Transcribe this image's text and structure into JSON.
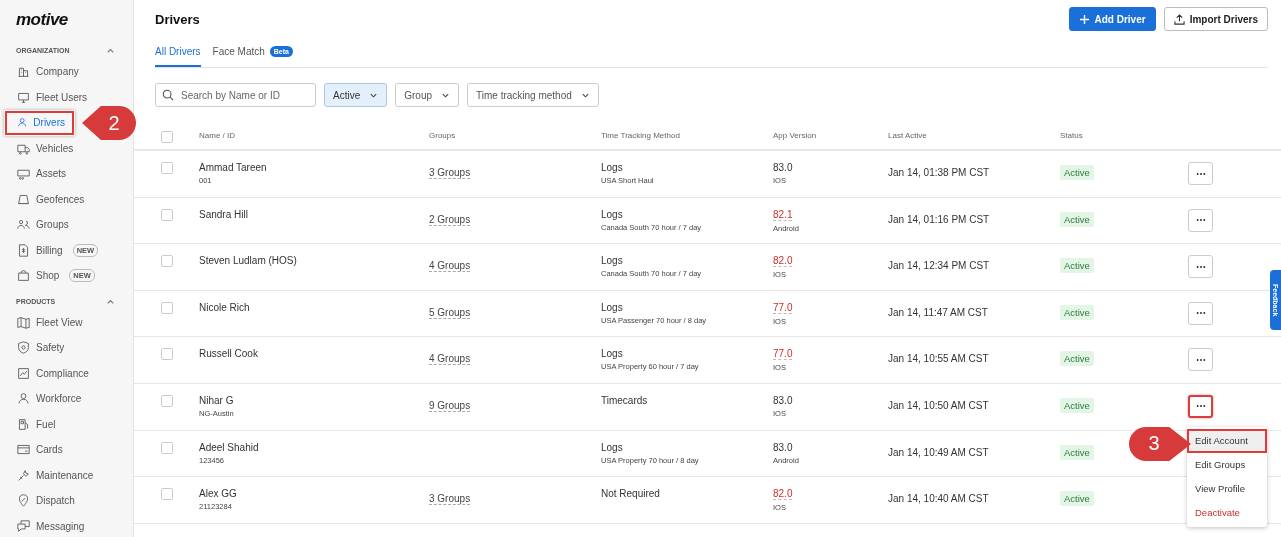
{
  "sidebar": {
    "logo": "motive",
    "sections": [
      {
        "title": "ORGANIZATION",
        "expanded": true,
        "items": [
          {
            "label": "Company",
            "selected": false
          },
          {
            "label": "Fleet Users",
            "selected": false
          },
          {
            "label": "Drivers",
            "selected": true,
            "callout": "2"
          },
          {
            "label": "Vehicles",
            "selected": false
          },
          {
            "label": "Assets",
            "selected": false
          },
          {
            "label": "Geofences",
            "selected": false
          },
          {
            "label": "Groups",
            "selected": false
          },
          {
            "label": "Billing",
            "selected": false,
            "badge": "NEW"
          },
          {
            "label": "Shop",
            "selected": false,
            "badge": "NEW"
          }
        ]
      },
      {
        "title": "PRODUCTS",
        "expanded": true,
        "items": [
          {
            "label": "Fleet View",
            "selected": false
          },
          {
            "label": "Safety",
            "selected": false
          },
          {
            "label": "Compliance",
            "selected": false
          },
          {
            "label": "Workforce",
            "selected": false
          },
          {
            "label": "Fuel",
            "selected": false
          },
          {
            "label": "Cards",
            "selected": false
          },
          {
            "label": "Maintenance",
            "selected": false
          },
          {
            "label": "Dispatch",
            "selected": false
          },
          {
            "label": "Messaging",
            "selected": false
          }
        ]
      }
    ]
  },
  "page": {
    "title": "Drivers",
    "buttons": [
      {
        "label": "Add Driver",
        "kind": "primary"
      },
      {
        "label": "Import Drivers",
        "kind": "secondary"
      }
    ]
  },
  "tabs": [
    {
      "label": "All Drivers",
      "selected": true
    },
    {
      "label": "Face Match",
      "selected": false,
      "badge": "Beta"
    }
  ],
  "filters": {
    "search": {
      "placeholder": "Search by Name or ID"
    },
    "dropdowns": [
      {
        "label": "Active",
        "selected": true
      },
      {
        "label": "Group",
        "selected": false
      },
      {
        "label": "Time tracking method",
        "selected": false
      }
    ]
  },
  "table": {
    "all_checked": false,
    "columns": [
      "Name / ID",
      "Groups",
      "Time Tracking Method",
      "App Version",
      "Last Active",
      "Status"
    ],
    "rows": [
      {
        "checked": false,
        "name": "Ammad Tareen",
        "id": "001",
        "groups": "3 Groups",
        "method": "Logs",
        "method_detail": "USA Short Haul",
        "version": "83.0",
        "outdated": false,
        "platform": "IOS",
        "last_active": "Jan 14, 01:38 PM CST",
        "status": "Active",
        "highlighted": false
      },
      {
        "checked": false,
        "name": "Sandra Hill",
        "groups": "2 Groups",
        "method": "Logs",
        "method_detail": "Canada South 70 hour / 7 day",
        "version": "82.1",
        "outdated": true,
        "platform": "Android",
        "last_active": "Jan 14, 01:16 PM CST",
        "status": "Active",
        "highlighted": false
      },
      {
        "checked": false,
        "name": "Steven Ludlam (HOS)",
        "groups": "4 Groups",
        "method": "Logs",
        "method_detail": "Canada South 70 hour / 7 day",
        "version": "82.0",
        "outdated": true,
        "platform": "IOS",
        "last_active": "Jan 14, 12:34 PM CST",
        "status": "Active",
        "highlighted": false
      },
      {
        "checked": false,
        "name": "Nicole Rich",
        "groups": "5 Groups",
        "method": "Logs",
        "method_detail": "USA Passenger 70 hour / 8 day",
        "version": "77.0",
        "outdated": true,
        "platform": "IOS",
        "last_active": "Jan 14, 11:47 AM CST",
        "status": "Active",
        "highlighted": false
      },
      {
        "checked": false,
        "name": "Russell Cook",
        "groups": "4 Groups",
        "method": "Logs",
        "method_detail": "USA Property 60 hour / 7 day",
        "version": "77.0",
        "outdated": true,
        "platform": "IOS",
        "last_active": "Jan 14, 10:55 AM CST",
        "status": "Active",
        "highlighted": false
      },
      {
        "checked": false,
        "name": "Nihar G",
        "id": "NG-Austin",
        "groups": "9 Groups",
        "method": "Timecards",
        "version": "83.0",
        "outdated": false,
        "platform": "IOS",
        "last_active": "Jan 14, 10:50 AM CST",
        "status": "Active",
        "highlighted": true,
        "menu": [
          {
            "label": "Edit Account",
            "kind": "normal",
            "selected": true,
            "callout": "3"
          },
          {
            "label": "Edit Groups",
            "kind": "normal",
            "selected": false
          },
          {
            "label": "View Profile",
            "kind": "normal",
            "selected": false
          },
          {
            "label": "Deactivate",
            "kind": "danger",
            "selected": false
          }
        ]
      },
      {
        "checked": false,
        "name": "Adeel Shahid",
        "id": "123456",
        "method": "Logs",
        "method_detail": "USA Property 70 hour / 8 day",
        "version": "83.0",
        "outdated": false,
        "platform": "Android",
        "last_active": "Jan 14, 10:49 AM CST",
        "status": "Active"
      },
      {
        "checked": false,
        "name": "Alex GG",
        "id": "21123284",
        "groups": "3 Groups",
        "method": "Not Required",
        "version": "82.0",
        "outdated": true,
        "platform": "IOS",
        "last_active": "Jan 14, 10:40 AM CST",
        "status": "Active"
      }
    ]
  },
  "feedback_tab": {
    "label": "Feedback"
  }
}
